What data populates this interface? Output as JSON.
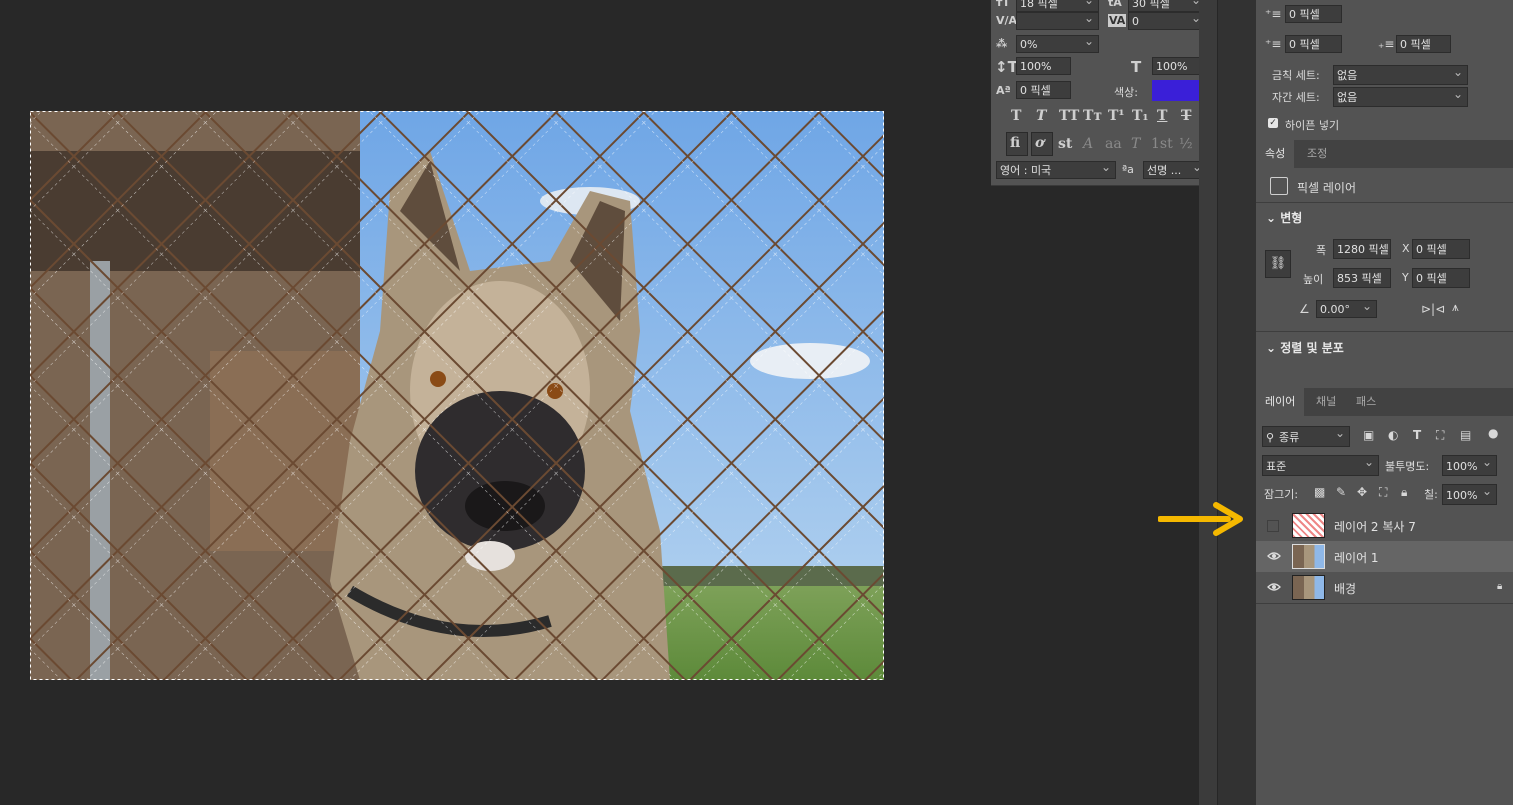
{
  "character": {
    "font_size": "18 픽셀",
    "leading": "30 픽셀",
    "kerning": "",
    "tracking": "0",
    "tsume": "0%",
    "vscale": "100%",
    "hscale": "100%",
    "baseline": "0 픽셀",
    "color_label": "색상:",
    "color": "#3a1fd8",
    "language": "영어 : 미국",
    "aa_label": "ªa",
    "antialias": "선명 ...",
    "style_buttons": [
      "T",
      "T",
      "TT",
      "Tт",
      "T¹",
      "T₁",
      "T",
      "T"
    ],
    "opentype_buttons": [
      "fi",
      "ơ",
      "st",
      "𝒜",
      "aa",
      "T",
      "1st",
      "½"
    ]
  },
  "paragraph": {
    "space_before": "0 픽셀",
    "space_after": "0 픽셀",
    "indent_first": "0 픽셀",
    "kinsoku_label": "금칙 세트:",
    "kinsoku_value": "없음",
    "mojikumi_label": "자간 세트:",
    "mojikumi_value": "없음",
    "hyphenate_label": "하이픈 넣기",
    "hyphenate_checked": true
  },
  "properties": {
    "tabs": [
      "속성",
      "조정"
    ],
    "layer_type": "픽셀 레이어",
    "transform_title": "변형",
    "width_label": "폭",
    "width": "1280 픽셀",
    "height_label": "높이",
    "height": "853 픽셀",
    "x_label": "X",
    "x": "0 픽셀",
    "y_label": "Y",
    "y": "0 픽셀",
    "angle": "0.00°",
    "align_title": "정렬 및 분포"
  },
  "layers": {
    "tabs": [
      "레이어",
      "채널",
      "패스"
    ],
    "filter_kind": "종류",
    "blend_mode": "표준",
    "opacity_label": "불투명도:",
    "opacity": "100%",
    "lock_label": "잠그기:",
    "fill_label": "칠:",
    "fill": "100%",
    "items": [
      {
        "name": "레이어 2 복사 7",
        "visible": false
      },
      {
        "name": "레이어 1",
        "visible": true,
        "selected": true
      },
      {
        "name": "배경",
        "visible": true,
        "locked": true
      }
    ]
  },
  "annotation": {
    "arrow_color": "#f5b800"
  }
}
